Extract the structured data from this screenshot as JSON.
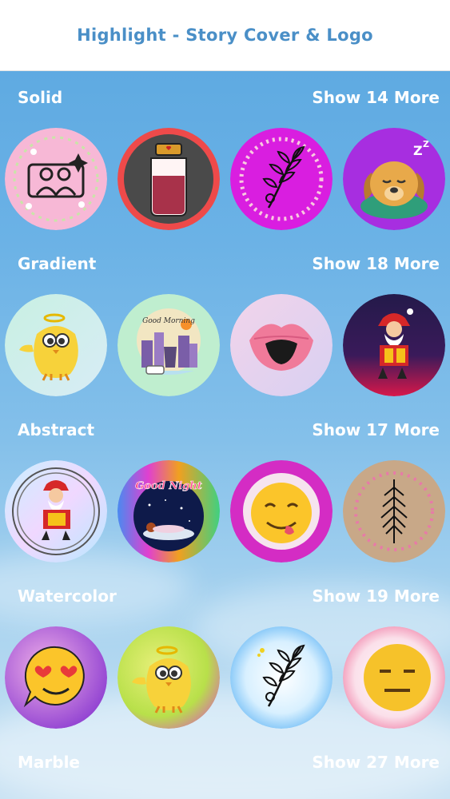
{
  "header": {
    "title": "Highlight - Story Cover & Logo"
  },
  "sections": [
    {
      "title": "Solid",
      "more": "Show 14 More"
    },
    {
      "title": "Gradient",
      "more": "Show 18 More"
    },
    {
      "title": "Abstract",
      "more": "Show 17 More"
    },
    {
      "title": "Watercolor",
      "more": "Show 19 More"
    },
    {
      "title": "Marble",
      "more": "Show 27 More"
    }
  ],
  "cover_text": {
    "good_morning": "Good Morning",
    "good_night": "Good Night"
  },
  "icons": [
    "selfie-couple-icon",
    "jar-icon",
    "leaf-branch-icon",
    "sleeping-dog-icon",
    "angel-chick-icon",
    "coffee-city-icon",
    "lips-icon",
    "santa-gift-icon",
    "santa-gift-icon",
    "sleeping-girl-icon",
    "tongue-emoji-icon",
    "fern-leaf-icon",
    "heart-eyes-emoji-icon",
    "angel-chick-icon",
    "leaf-branch-icon",
    "neutral-emoji-icon"
  ]
}
